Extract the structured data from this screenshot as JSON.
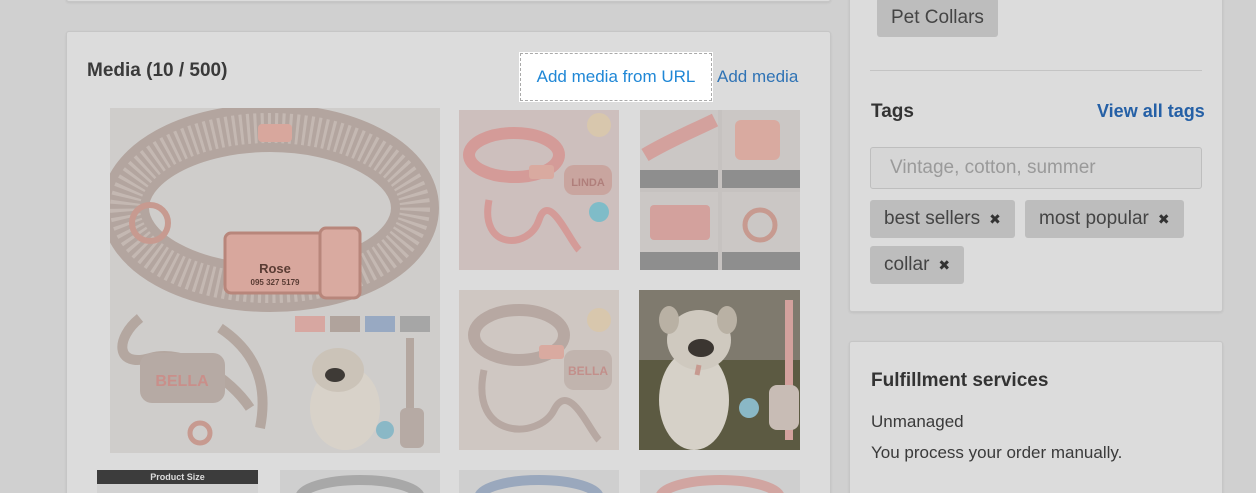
{
  "media": {
    "title": "Media (10 / 500)",
    "add_from_url_label": "Add media from URL",
    "add_media_label": "Add media",
    "items": [
      {
        "desc": "collar-main",
        "text": "Rose",
        "phone": "095 327 5179",
        "pouch_text": "BELLA"
      },
      {
        "desc": "collar-leash-pouch",
        "pouch_text": "LINDA"
      },
      {
        "desc": "detail-grid"
      },
      {
        "desc": "collar-leash-pouch-2",
        "pouch_text": "BELLA"
      },
      {
        "desc": "dog-photo"
      },
      {
        "desc": "product-size",
        "banner": "Product Size"
      },
      {
        "desc": "collar-gray"
      },
      {
        "desc": "collar-blue"
      },
      {
        "desc": "collar-pink"
      }
    ]
  },
  "collection_chip": "Pet Collars",
  "tags": {
    "title": "Tags",
    "view_all_label": "View all tags",
    "input_placeholder": "Vintage, cotton, summer",
    "items": [
      "best sellers",
      "most popular",
      "collar"
    ],
    "remove_glyph": "✖"
  },
  "fulfillment": {
    "title": "Fulfillment services",
    "status": "Unmanaged",
    "description": "You process your order manually."
  },
  "colors": {
    "link": "#2f73b5",
    "highlight_link": "#1f87d6",
    "overlay": "#d0d0d0"
  }
}
